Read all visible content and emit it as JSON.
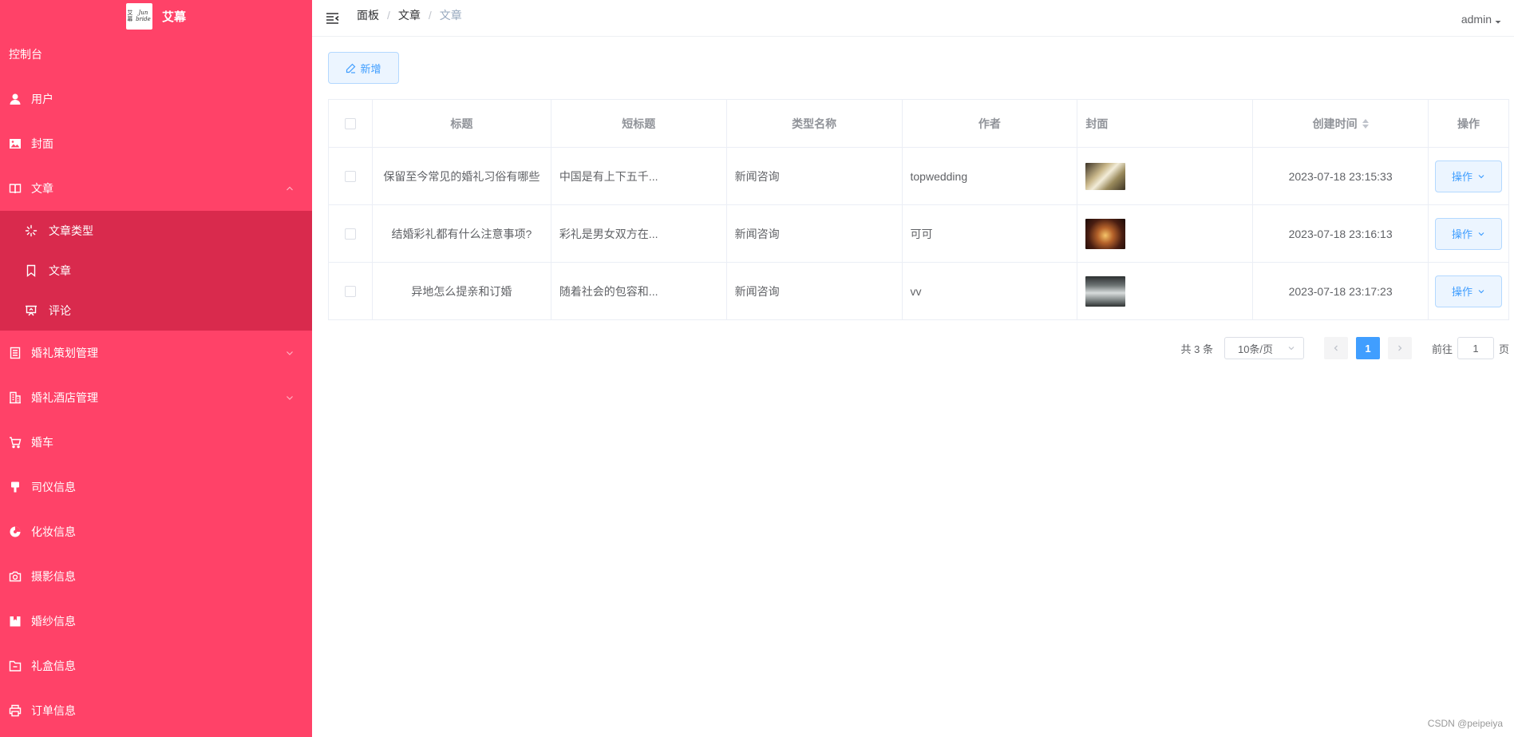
{
  "logo": {
    "text": "艾幕",
    "img_text": "艾幕 Jun bride"
  },
  "sidebar": {
    "dashboard": "控制台",
    "items": [
      {
        "label": "用户",
        "icon": "user-icon"
      },
      {
        "label": "封面",
        "icon": "picture-icon"
      },
      {
        "label": "文章",
        "icon": "book-icon",
        "expanded": true
      },
      {
        "label": "文章类型",
        "icon": "loading-icon",
        "sub": true
      },
      {
        "label": "文章",
        "icon": "bookmark-icon",
        "sub": true
      },
      {
        "label": "评论",
        "icon": "presentation-icon",
        "sub": true
      },
      {
        "label": "婚礼策划管理",
        "icon": "document-icon"
      },
      {
        "label": "婚礼酒店管理",
        "icon": "office-building-icon"
      },
      {
        "label": "婚车",
        "icon": "cart-icon"
      },
      {
        "label": "司仪信息",
        "icon": "brush-icon"
      },
      {
        "label": "化妆信息",
        "icon": "pie-icon"
      },
      {
        "label": "摄影信息",
        "icon": "camera-icon"
      },
      {
        "label": "婚纱信息",
        "icon": "box-icon"
      },
      {
        "label": "礼盒信息",
        "icon": "folder-icon"
      },
      {
        "label": "订单信息",
        "icon": "printer-icon"
      }
    ]
  },
  "header": {
    "breadcrumb": [
      "面板",
      "文章",
      "文章"
    ],
    "user": "admin"
  },
  "toolbar": {
    "add_label": "新增"
  },
  "table": {
    "columns": [
      "标题",
      "短标题",
      "类型名称",
      "作者",
      "封面",
      "创建时间",
      "操作"
    ],
    "rows": [
      {
        "title": "保留至今常见的婚礼习俗有哪些",
        "short": "中国是有上下五千...",
        "type": "新闻咨询",
        "author": "topwedding",
        "time": "2023-07-18 23:15:33",
        "op": "操作"
      },
      {
        "title": "结婚彩礼都有什么注意事项?",
        "short": "彩礼是男女双方在...",
        "type": "新闻咨询",
        "author": "可可",
        "time": "2023-07-18 23:16:13",
        "op": "操作"
      },
      {
        "title": "异地怎么提亲和订婚",
        "short": "随着社会的包容和...",
        "type": "新闻咨询",
        "author": "vv",
        "time": "2023-07-18 23:17:23",
        "op": "操作"
      }
    ]
  },
  "pagination": {
    "total": "共 3 条",
    "page_size": "10条/页",
    "current": "1",
    "goto_prefix": "前往",
    "goto_value": "1",
    "goto_suffix": "页"
  },
  "watermark": "CSDN @peipeiya",
  "colors": {
    "sidebar": "#ff4268",
    "submenu": "#d92a4d",
    "primary": "#409eff"
  }
}
